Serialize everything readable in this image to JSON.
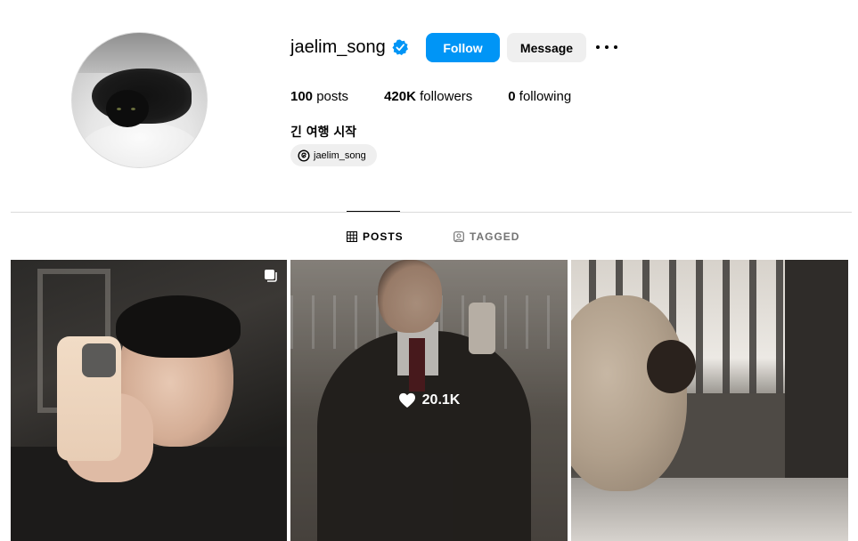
{
  "profile": {
    "username": "jaelim_song",
    "verified": true,
    "follow_label": "Follow",
    "message_label": "Message",
    "stats": {
      "posts_count": "100",
      "posts_label": " posts",
      "followers_count": "420K",
      "followers_label": " followers",
      "following_count": "0",
      "following_label": " following"
    },
    "bio": "긴 여행 시작",
    "threads_handle": "jaelim_song"
  },
  "tabs": [
    {
      "label": "POSTS",
      "active": true
    },
    {
      "label": "TAGGED",
      "active": false
    }
  ],
  "posts": [
    {
      "icon": "multiple-photos-icon"
    },
    {
      "likes": "20.1K"
    },
    {}
  ],
  "colors": {
    "accent": "#0095f6",
    "secondary_button": "#efefef",
    "divider": "#dbdbdb",
    "muted_text": "#737373"
  }
}
